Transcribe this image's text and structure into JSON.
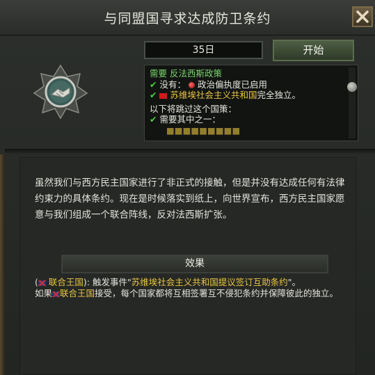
{
  "window": {
    "title": "与同盟国寻求达成防卫条约",
    "close_label": "close"
  },
  "action": {
    "days": "35日",
    "start_label": "开始"
  },
  "requirements": {
    "header": "需要 反法西斯政策",
    "line1_prefix": "没有：",
    "line1_value": "政治偏执度已启用",
    "line2_country": "苏维埃社会主义共和国",
    "line2_suffix": "完全独立。",
    "skip_header": "以下将跳过这个国策：",
    "skip_line": "需要其中之一：",
    "cut_line": "■■■■■■■■■"
  },
  "description": {
    "text": "虽然我们与西方民主国家进行了非正式的接触，但是并没有达成任何有法律约束力的具体条约。现在是时候落实到纸上，向世界宣布，西方民主国家愿意与我们组成一个联合阵线，反对法西斯扩张。"
  },
  "effects": {
    "header": "效果",
    "line1_open": "(",
    "line1_country": "联合王国",
    "line1_mid": "): 触发事件\"",
    "line1_event": "苏维埃社会主义共和国提议签订互助条约",
    "line1_end": "\"。",
    "line2_prefix": "如果",
    "line2_country": "联合王国",
    "line2_rest": "接受，每个国家都将互相签署互不侵犯条约并保障彼此的独立。"
  },
  "icons": {
    "medal": "handshake-medal-icon",
    "close": "close-icon",
    "check": "check-icon"
  },
  "colors": {
    "requirement_green": "#79d46c",
    "highlight_yellow": "#e8c542",
    "check_green": "#4fcf42",
    "start_button": "#4e5e44"
  }
}
